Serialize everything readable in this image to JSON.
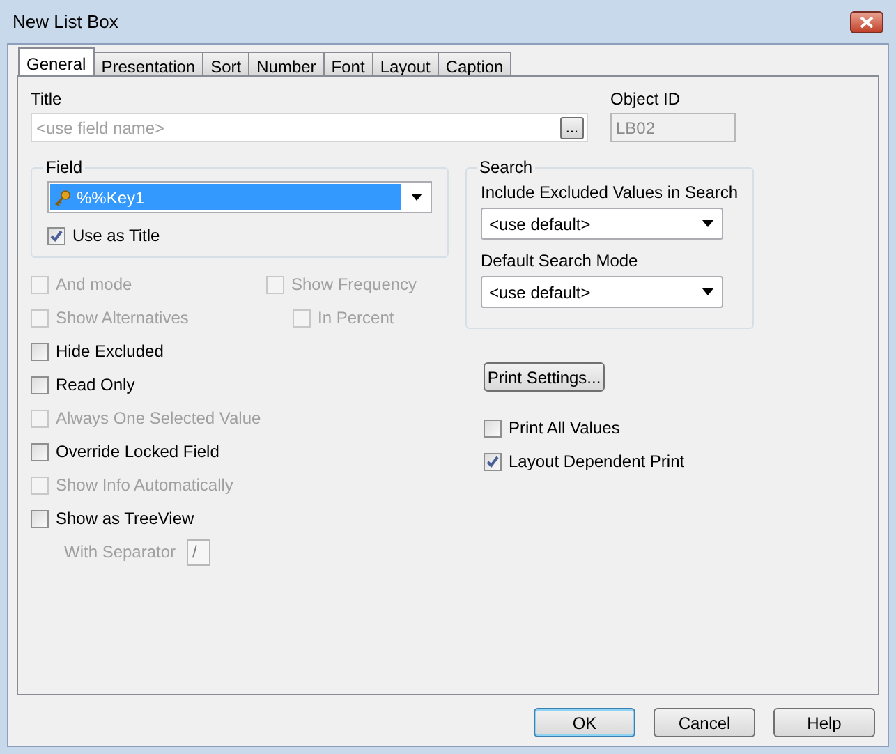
{
  "window": {
    "title": "New List Box"
  },
  "tabs": [
    {
      "label": "General",
      "selected": true
    },
    {
      "label": "Presentation",
      "selected": false
    },
    {
      "label": "Sort",
      "selected": false
    },
    {
      "label": "Number",
      "selected": false
    },
    {
      "label": "Font",
      "selected": false
    },
    {
      "label": "Layout",
      "selected": false
    },
    {
      "label": "Caption",
      "selected": false
    }
  ],
  "title_field": {
    "label": "Title",
    "placeholder": "<use field name>",
    "browse_button": "..."
  },
  "object_id": {
    "label": "Object ID",
    "value": "LB02",
    "disabled": true
  },
  "field_group": {
    "legend": "Field",
    "value": "%%Key1",
    "use_as_title": {
      "label": "Use as Title",
      "checked": true,
      "disabled": false
    }
  },
  "show_frequency": {
    "label": "Show Frequency",
    "checked": false,
    "disabled": true
  },
  "in_percent": {
    "label": "In Percent",
    "checked": false,
    "disabled": true
  },
  "left_options": [
    {
      "label": "And mode",
      "checked": false,
      "disabled": true
    },
    {
      "label": "Show Alternatives",
      "checked": false,
      "disabled": true
    },
    {
      "label": "Hide Excluded",
      "checked": false,
      "disabled": false
    },
    {
      "label": "Read Only",
      "checked": false,
      "disabled": false
    },
    {
      "label": "Always One Selected Value",
      "checked": false,
      "disabled": true
    },
    {
      "label": "Override Locked Field",
      "checked": false,
      "disabled": false
    },
    {
      "label": "Show Info Automatically",
      "checked": false,
      "disabled": true
    },
    {
      "label": "Show as TreeView",
      "checked": false,
      "disabled": false
    }
  ],
  "separator": {
    "label": "With Separator",
    "value": "/",
    "disabled": true
  },
  "search_group": {
    "legend": "Search",
    "include_label": "Include Excluded Values in Search",
    "include_value": "<use default>",
    "mode_label": "Default Search Mode",
    "mode_value": "<use default>"
  },
  "print_settings_button": "Print Settings...",
  "print_options": [
    {
      "label": "Print All Values",
      "checked": false,
      "disabled": false
    },
    {
      "label": "Layout Dependent Print",
      "checked": true,
      "disabled": false
    }
  ],
  "buttons": [
    {
      "label": "OK",
      "default": true
    },
    {
      "label": "Cancel",
      "default": false
    },
    {
      "label": "Help",
      "default": false
    }
  ]
}
